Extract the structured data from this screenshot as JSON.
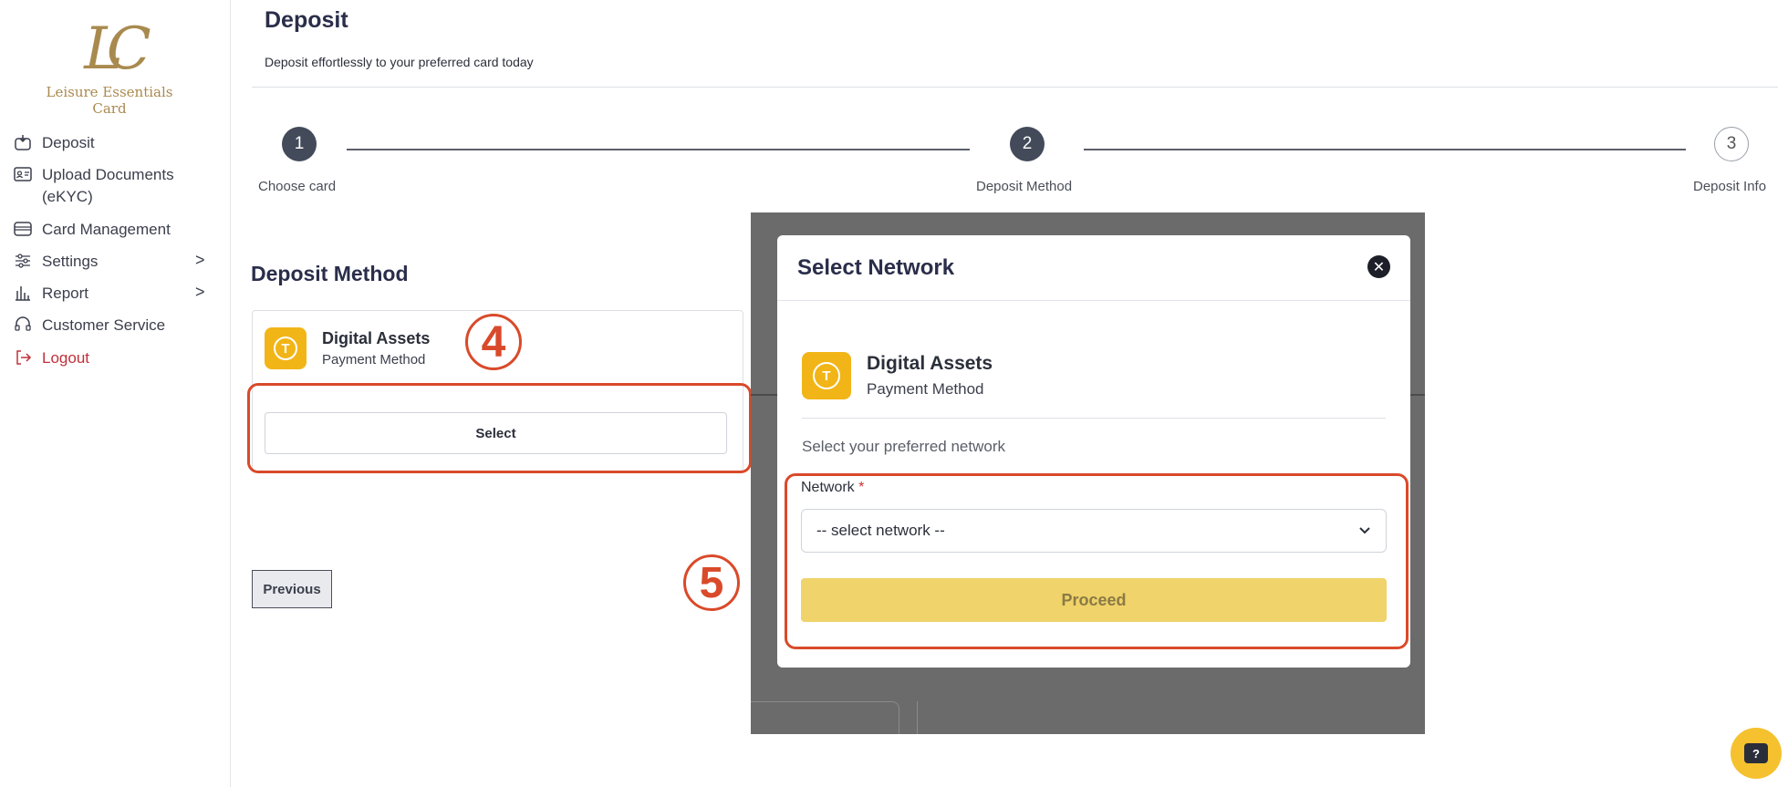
{
  "brand": {
    "monogram": "LC",
    "name": "Leisure Essentials Card"
  },
  "sidebar": {
    "items": [
      {
        "label": "Deposit",
        "icon": "deposit-icon"
      },
      {
        "label": "Upload Documents\n(eKYC)",
        "icon": "id-card-icon"
      },
      {
        "label": "Card Management",
        "icon": "card-icon"
      },
      {
        "label": "Settings",
        "icon": "sliders-icon"
      },
      {
        "label": "Report",
        "icon": "bar-chart-icon"
      },
      {
        "label": "Customer Service",
        "icon": "headset-icon"
      },
      {
        "label": "Logout",
        "icon": "logout-icon"
      }
    ],
    "chevron": ">"
  },
  "page": {
    "title": "Deposit",
    "subtitle": "Deposit effortlessly to your preferred card today"
  },
  "stepper": {
    "steps": [
      {
        "number": "1",
        "label": "Choose card",
        "state": "done"
      },
      {
        "number": "2",
        "label": "Deposit Method",
        "state": "active"
      },
      {
        "number": "3",
        "label": "Deposit Info",
        "state": "todo"
      }
    ]
  },
  "deposit_method": {
    "section_title": "Deposit Method",
    "card_name": "Digital Assets",
    "card_sub": "Payment Method",
    "coin_symbol": "T",
    "select_label": "Select"
  },
  "previous_label": "Previous",
  "modal": {
    "title": "Select Network",
    "close_symbol": "✕",
    "method_name": "Digital Assets",
    "method_sub": "Payment Method",
    "coin_symbol": "T",
    "prompt": "Select your preferred network",
    "network_label": "Network",
    "required_mark": "*",
    "select_value": "-- select network --",
    "proceed_label": "Proceed"
  },
  "annotations": {
    "step4": "4",
    "step5": "5"
  },
  "help_symbol": "?",
  "colors": {
    "accent_gold": "#f2b517",
    "proceed_bg": "#f0d36a",
    "annotation_red": "#d94a2a",
    "logout_red": "#c0303a",
    "step_dark": "#434a59"
  }
}
